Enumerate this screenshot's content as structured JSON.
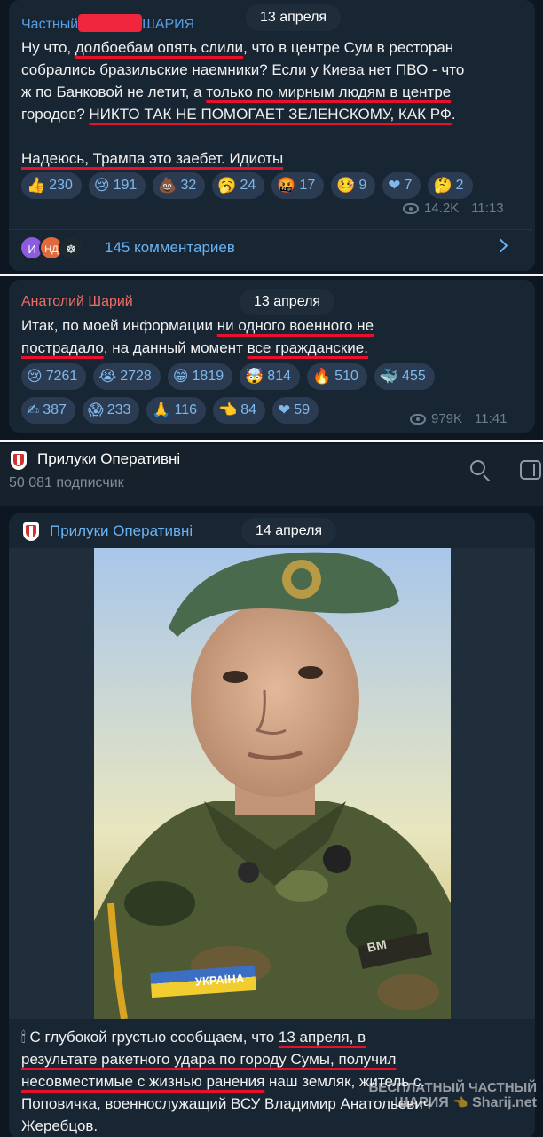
{
  "post1": {
    "author_pre": "Частный",
    "author_post": "ШАРИЯ",
    "date": "13 апреля",
    "text": {
      "l1a": "Ну что, ",
      "l1u": "долбоебам опять слили",
      "l1b": ", что в центре Сум в ресторан",
      "l2": "собрались бразильские наемники? Если у Киева нет ПВО - что",
      "l3a": "ж по Банковой не летит, а ",
      "l3u": "только по мирным людям в центре",
      "l4a": "городов? ",
      "l4u": "НИКТО ТАК НЕ ПОМОГАЕТ ЗЕЛЕНСКОМУ, КАК РФ",
      "l4b": ".",
      "l5u": "Надеюсь, Трампа это заебет. Идиоты"
    },
    "reactions": [
      {
        "emoji": "👍",
        "count": "230"
      },
      {
        "emoji": "😢",
        "count": "191"
      },
      {
        "emoji": "💩",
        "count": "32"
      },
      {
        "emoji": "🥱",
        "count": "24"
      },
      {
        "emoji": "🤬",
        "count": "17"
      },
      {
        "emoji": "🤒",
        "count": "9"
      },
      {
        "emoji": "❤",
        "count": "7"
      },
      {
        "emoji": "🤔",
        "count": "2"
      }
    ],
    "views": "14.2K",
    "time": "11:13",
    "avatars": [
      "И",
      "НД",
      "☸"
    ],
    "comments_label": "145 комментариев"
  },
  "post2": {
    "author": "Анатолий Шарий",
    "date": "13 апреля",
    "text": {
      "l1a": "Итак, по моей информации ",
      "l1u": "ни одного военного не",
      "l2u": "пострадало",
      "l2b": ", на данный момент ",
      "l2u2": "все гражданские."
    },
    "reactions": [
      {
        "emoji": "😢",
        "count": "7261"
      },
      {
        "emoji": "😭",
        "count": "2728"
      },
      {
        "emoji": "😁",
        "count": "1819"
      },
      {
        "emoji": "🤯",
        "count": "814"
      },
      {
        "emoji": "🔥",
        "count": "510"
      },
      {
        "emoji": "🐳",
        "count": "455"
      },
      {
        "emoji": "✍",
        "count": "387"
      },
      {
        "emoji": "😱",
        "count": "233"
      },
      {
        "emoji": "🙏",
        "count": "116"
      },
      {
        "emoji": "👈",
        "count": "84"
      },
      {
        "emoji": "❤",
        "count": "59"
      }
    ],
    "views": "979K",
    "time": "11:41"
  },
  "channel": {
    "name": "Прилуки Оперативні",
    "subscribers": "50 081 подписчик"
  },
  "post3": {
    "author": "Прилуки Оперативні",
    "date": "14 апреля",
    "patch_text": "УКРАЇНА",
    "collar_text": "ВМ",
    "text": {
      "l1a": "🕯 С глубокой грустью сообщаем, что ",
      "l1u": "13 апреля, в",
      "l2u": "результате ракетного удара по городу Сумы, получил",
      "l3u": "несовместимые с жизнью ранения",
      "l3b": " наш земляк, житель с.",
      "l4": "Поповичка, военнослужащий ВСУ Владимир Анатольевич",
      "l5": "Жеребцов."
    }
  },
  "watermark": {
    "line1": "БЕСПЛАТНЫЙ ЧАСТНЫЙ",
    "line2": "ШАРИЯ",
    "line3": "Sharij.net"
  }
}
